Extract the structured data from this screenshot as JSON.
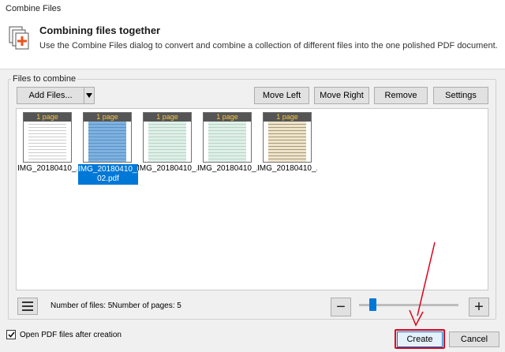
{
  "window": {
    "title": "Combine Files"
  },
  "header": {
    "title": "Combining files together",
    "description": "Use the Combine Files dialog to convert and combine a collection of different files into the one polished PDF document."
  },
  "files_group": {
    "label": "Files to combine"
  },
  "toolbar": {
    "add_files": "Add Files...",
    "move_left": "Move Left",
    "move_right": "Move Right",
    "remove": "Remove",
    "settings": "Settings"
  },
  "files": [
    {
      "badge": "1 page",
      "label": "IMG_20180410_...",
      "selected": false,
      "tint": "white"
    },
    {
      "badge": "1 page",
      "label": "IMG_20180410_0002.pdf",
      "label_line1": "IMG_20180410_00",
      "label_line2": "02.pdf",
      "selected": true,
      "tint": "blue"
    },
    {
      "badge": "1 page",
      "label": "IMG_20180410_...",
      "selected": false,
      "tint": "green"
    },
    {
      "badge": "1 page",
      "label": "IMG_20180410_...",
      "selected": false,
      "tint": "green"
    },
    {
      "badge": "1 page",
      "label": "IMG_20180410_...",
      "selected": false,
      "tint": "beige"
    }
  ],
  "stats": {
    "num_files": "Number of files: 5",
    "num_pages": "Number of pages: 5"
  },
  "zoom": {
    "minus": "−",
    "plus": "+",
    "level": 0.12
  },
  "options": {
    "open_after_creation": "Open PDF files after creation",
    "checked": true
  },
  "buttons": {
    "create": "Create",
    "cancel": "Cancel"
  },
  "colors": {
    "accent": "#0078d7",
    "highlight": "#e0001a",
    "badge_text": "#f5c542"
  }
}
